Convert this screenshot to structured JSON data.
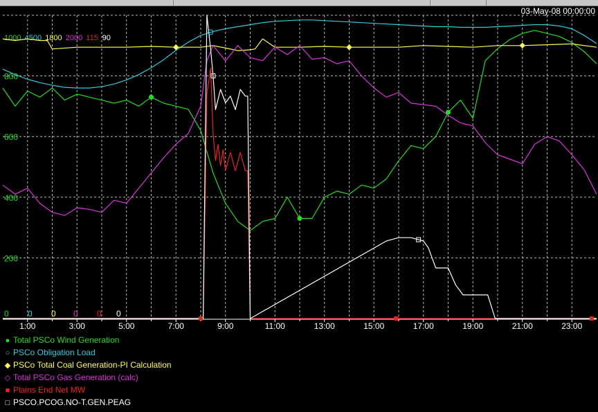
{
  "timestamp": "03-May-08 00:00:00",
  "scale_labels": [
    {
      "text": "1000",
      "color": "#22dd22"
    },
    {
      "text": "4500",
      "color": "#33ccdd"
    },
    {
      "text": "1800",
      "color": "#ffff55"
    },
    {
      "text": "2000",
      "color": "#dd33dd"
    },
    {
      "text": "115",
      "color": "#ee2222"
    },
    {
      "text": "90",
      "color": "#ffffff"
    }
  ],
  "zero_labels": [
    {
      "text": "0",
      "color": "#22dd22"
    },
    {
      "text": "0",
      "color": "#33ccdd"
    },
    {
      "text": "0",
      "color": "#ffff55"
    },
    {
      "text": "0",
      "color": "#dd33dd"
    },
    {
      "text": "0",
      "color": "#ee2222"
    },
    {
      "text": "0",
      "color": "#ffffff"
    }
  ],
  "legend": [
    {
      "label": "Total PSCo Wind Generation",
      "color": "#22dd22",
      "marker": "●"
    },
    {
      "label": "PSCo Obligation Load",
      "color": "#33ccdd",
      "marker": "○"
    },
    {
      "label": "PSCo Total Coal Generation-PI Calculation",
      "color": "#ffff55",
      "marker": "◆"
    },
    {
      "label": "Total PSCo Gas Generation (calc)",
      "color": "#dd33dd",
      "marker": "◇"
    },
    {
      "label": "Plains End Net MW",
      "color": "#ee2222",
      "marker": "■"
    },
    {
      "label": "PSCO.PCOG.NO-T.GEN.PEAG",
      "color": "#ffffff",
      "marker": "□"
    }
  ],
  "chart_data": {
    "type": "line",
    "xlabel": "",
    "ylabel": "",
    "xlim": [
      0,
      24
    ],
    "ylim": [
      0,
      1000
    ],
    "x_ticks": [
      "1:00",
      "3:00",
      "5:00",
      "7:00",
      "9:00",
      "11:00",
      "13:00",
      "15:00",
      "17:00",
      "19:00",
      "21:00",
      "23:00"
    ],
    "y_ticks": [
      "200",
      "400",
      "600",
      "800"
    ],
    "grid": true,
    "legend_position": "bottom",
    "series": [
      {
        "name": "Total PSCo Wind Generation",
        "color": "#22dd22",
        "scale_max": 1000,
        "x": [
          0,
          0.5,
          1,
          1.5,
          2,
          2.5,
          3,
          3.5,
          4,
          4.5,
          5,
          5.5,
          6,
          6.5,
          7,
          7.5,
          8,
          8.5,
          9,
          9.5,
          10,
          10.5,
          11,
          11.5,
          12,
          12.5,
          13,
          13.5,
          14,
          14.5,
          15,
          15.5,
          16,
          16.5,
          17,
          17.5,
          18,
          18.5,
          19,
          19.5,
          20,
          20.5,
          21,
          21.5,
          22,
          22.5,
          23,
          23.5,
          24
        ],
        "y": [
          760,
          700,
          750,
          730,
          760,
          720,
          740,
          730,
          720,
          710,
          720,
          700,
          730,
          710,
          700,
          690,
          620,
          480,
          380,
          320,
          290,
          320,
          330,
          400,
          330,
          330,
          400,
          420,
          410,
          440,
          430,
          460,
          520,
          570,
          560,
          600,
          680,
          720,
          660,
          850,
          890,
          920,
          940,
          950,
          940,
          930,
          910,
          880,
          840
        ]
      },
      {
        "name": "PSCo Obligation Load",
        "color": "#33ccdd",
        "scale_max": 4500,
        "x": [
          0,
          0.5,
          1,
          1.5,
          2,
          2.5,
          3,
          3.5,
          4,
          4.5,
          5,
          5.5,
          6,
          6.5,
          7,
          7.5,
          8,
          8.5,
          9,
          9.5,
          10,
          10.5,
          11,
          11.5,
          12,
          12.5,
          13,
          13.5,
          14,
          14.5,
          15,
          15.5,
          16,
          16.5,
          17,
          17.5,
          18,
          18.5,
          19,
          19.5,
          20,
          20.5,
          21,
          21.5,
          22,
          22.5,
          23,
          23.5,
          24
        ],
        "y": [
          3700,
          3620,
          3550,
          3500,
          3460,
          3430,
          3420,
          3420,
          3440,
          3480,
          3540,
          3620,
          3720,
          3840,
          3980,
          4100,
          4200,
          4260,
          4300,
          4330,
          4360,
          4390,
          4410,
          4420,
          4430,
          4430,
          4420,
          4410,
          4400,
          4390,
          4380,
          4370,
          4360,
          4350,
          4340,
          4330,
          4330,
          4320,
          4320,
          4320,
          4330,
          4340,
          4350,
          4360,
          4360,
          4340,
          4300,
          4200,
          4080
        ]
      },
      {
        "name": "PSCo Total Coal Generation-PI Calculation",
        "color": "#ffff55",
        "scale_max": 1800,
        "x": [
          0,
          0.5,
          1,
          1.5,
          1.8,
          2,
          3,
          4,
          5,
          6,
          7,
          8,
          8.5,
          9,
          9.5,
          10,
          10.2,
          10.5,
          11,
          12,
          13,
          14,
          15,
          16,
          17,
          18,
          19,
          20,
          21,
          22,
          23,
          24
        ],
        "y": [
          1660,
          1650,
          1660,
          1650,
          1650,
          1600,
          1610,
          1610,
          1610,
          1615,
          1610,
          1610,
          1620,
          1605,
          1590,
          1595,
          1600,
          1660,
          1610,
          1610,
          1615,
          1610,
          1610,
          1610,
          1620,
          1615,
          1610,
          1620,
          1620,
          1625,
          1630,
          1610
        ]
      },
      {
        "name": "Total PSCo Gas Generation (calc)",
        "color": "#dd33dd",
        "scale_max": 2000,
        "x": [
          0,
          0.5,
          1,
          1.5,
          2,
          2.5,
          3,
          3.5,
          4,
          4.5,
          5,
          5.5,
          6,
          6.5,
          7,
          7.5,
          8,
          8.25,
          8.5,
          9,
          9.5,
          10,
          10.5,
          11,
          11.5,
          12,
          12.5,
          13,
          13.5,
          14,
          14.5,
          15,
          15.5,
          16,
          16.5,
          17,
          17.5,
          18,
          18.5,
          19,
          19.5,
          20,
          20.5,
          21,
          21.5,
          22,
          22.5,
          23,
          23.5,
          24
        ],
        "y": [
          880,
          820,
          860,
          760,
          700,
          680,
          730,
          720,
          700,
          780,
          760,
          860,
          960,
          1060,
          1150,
          1220,
          1400,
          1700,
          1800,
          1700,
          1800,
          1720,
          1700,
          1790,
          1740,
          1800,
          1710,
          1720,
          1680,
          1700,
          1600,
          1520,
          1460,
          1490,
          1420,
          1410,
          1400,
          1340,
          1290,
          1270,
          1160,
          1080,
          1050,
          1020,
          1150,
          1200,
          1170,
          1080,
          980,
          820
        ]
      },
      {
        "name": "Plains End Net MW",
        "color": "#ee2222",
        "scale_max": 115,
        "x": [
          0,
          8.1,
          8.25,
          8.4,
          8.5,
          8.6,
          8.7,
          8.8,
          8.9,
          9,
          9.2,
          9.4,
          9.6,
          9.8,
          9.9,
          10,
          24
        ],
        "y": [
          0,
          0,
          85,
          95,
          70,
          60,
          66,
          58,
          64,
          56,
          63,
          56,
          63,
          56,
          56,
          0,
          0
        ]
      },
      {
        "name": "PSCO.PCOG.NO-T.GEN.PEAG",
        "color": "#ffffff",
        "scale_max": 90,
        "x": [
          0,
          8.1,
          8.25,
          8.4,
          8.5,
          8.6,
          8.8,
          9,
          9.2,
          9.4,
          9.6,
          9.8,
          9.9,
          10,
          15.5,
          16,
          16.5,
          17,
          17.2,
          17.5,
          17.8,
          18,
          18.3,
          18.6,
          18.8,
          19,
          19.6,
          19.9,
          20,
          24
        ],
        "y": [
          0,
          0,
          90,
          80,
          72,
          62,
          68,
          64,
          66,
          62,
          68,
          66,
          66,
          0,
          23,
          24,
          24,
          23,
          21,
          15,
          15,
          15,
          10,
          7,
          7,
          7,
          7,
          0,
          0,
          0
        ]
      }
    ]
  }
}
